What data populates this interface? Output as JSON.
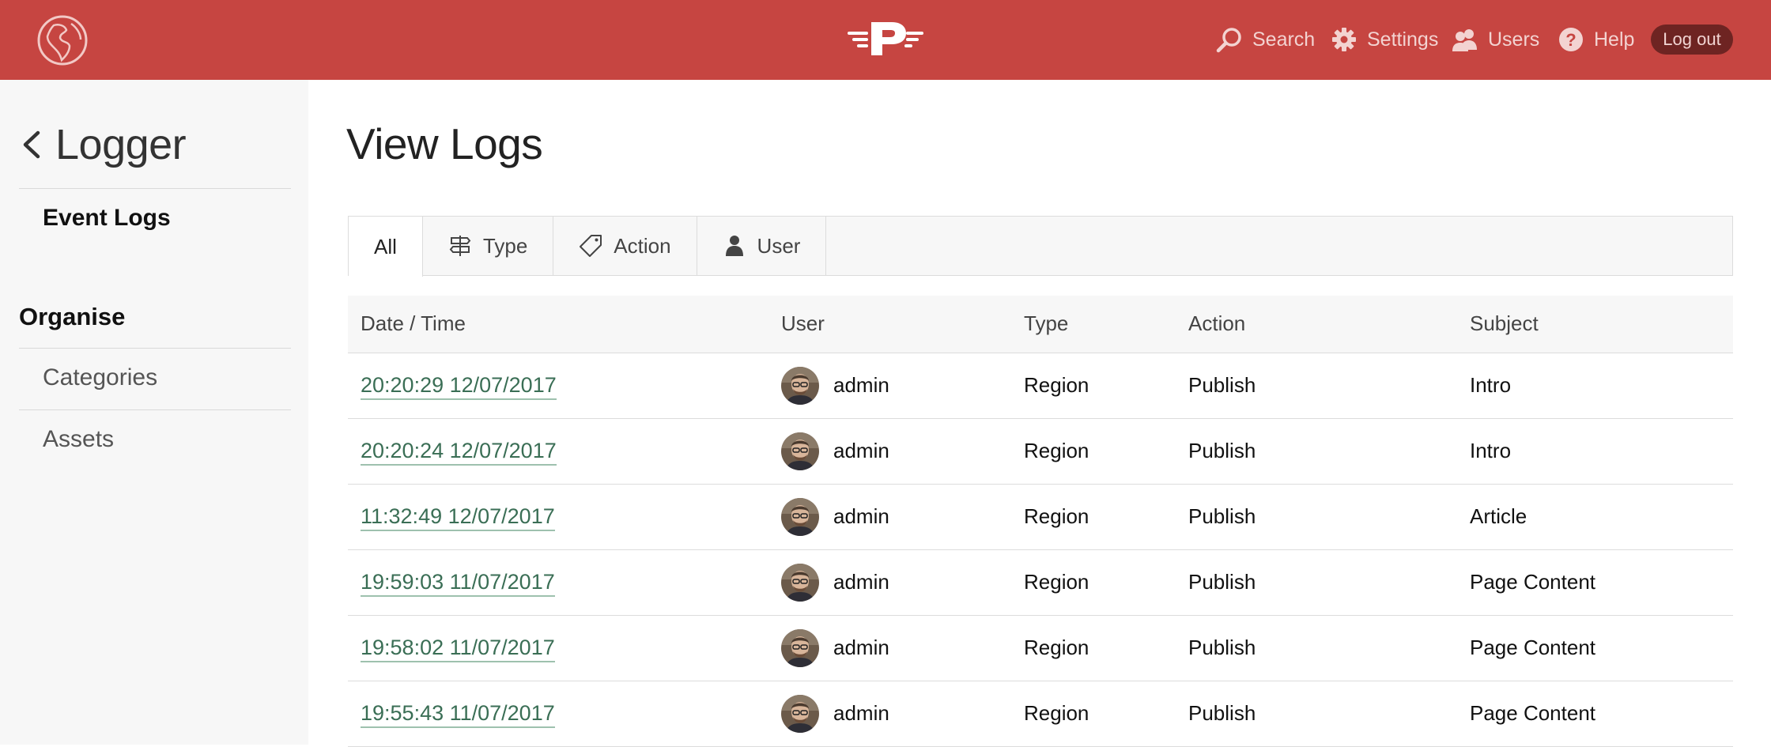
{
  "header": {
    "logo_icon": "globe-icon",
    "brand_icon": "winged-p-logo",
    "nav": [
      {
        "label": "Search",
        "icon": "search-icon"
      },
      {
        "label": "Settings",
        "icon": "gear-icon"
      },
      {
        "label": "Users",
        "icon": "users-icon"
      },
      {
        "label": "Help",
        "icon": "help-icon"
      }
    ],
    "logout_label": "Log out"
  },
  "sidebar": {
    "back_title": "Logger",
    "active_item": "Event Logs",
    "section_title": "Organise",
    "links": [
      "Categories",
      "Assets"
    ]
  },
  "main": {
    "title": "View Logs",
    "tabs": [
      {
        "label": "All",
        "icon": ""
      },
      {
        "label": "Type",
        "icon": "signpost-icon"
      },
      {
        "label": "Action",
        "icon": "tag-icon"
      },
      {
        "label": "User",
        "icon": "person-icon"
      }
    ],
    "table": {
      "columns": [
        "Date / Time",
        "User",
        "Type",
        "Action",
        "Subject"
      ],
      "rows": [
        {
          "datetime": "20:20:29 12/07/2017",
          "user": "admin",
          "type": "Region",
          "action": "Publish",
          "subject": "Intro"
        },
        {
          "datetime": "20:20:24 12/07/2017",
          "user": "admin",
          "type": "Region",
          "action": "Publish",
          "subject": "Intro"
        },
        {
          "datetime": "11:32:49 12/07/2017",
          "user": "admin",
          "type": "Region",
          "action": "Publish",
          "subject": "Article"
        },
        {
          "datetime": "19:59:03 11/07/2017",
          "user": "admin",
          "type": "Region",
          "action": "Publish",
          "subject": "Page Content"
        },
        {
          "datetime": "19:58:02 11/07/2017",
          "user": "admin",
          "type": "Region",
          "action": "Publish",
          "subject": "Page Content"
        },
        {
          "datetime": "19:55:43 11/07/2017",
          "user": "admin",
          "type": "Region",
          "action": "Publish",
          "subject": "Page Content"
        }
      ]
    }
  },
  "colors": {
    "header_bg": "#c64541",
    "sidebar_bg": "#f7f7f7",
    "link": "#3a6e55",
    "logout_bg": "#6e2422"
  }
}
